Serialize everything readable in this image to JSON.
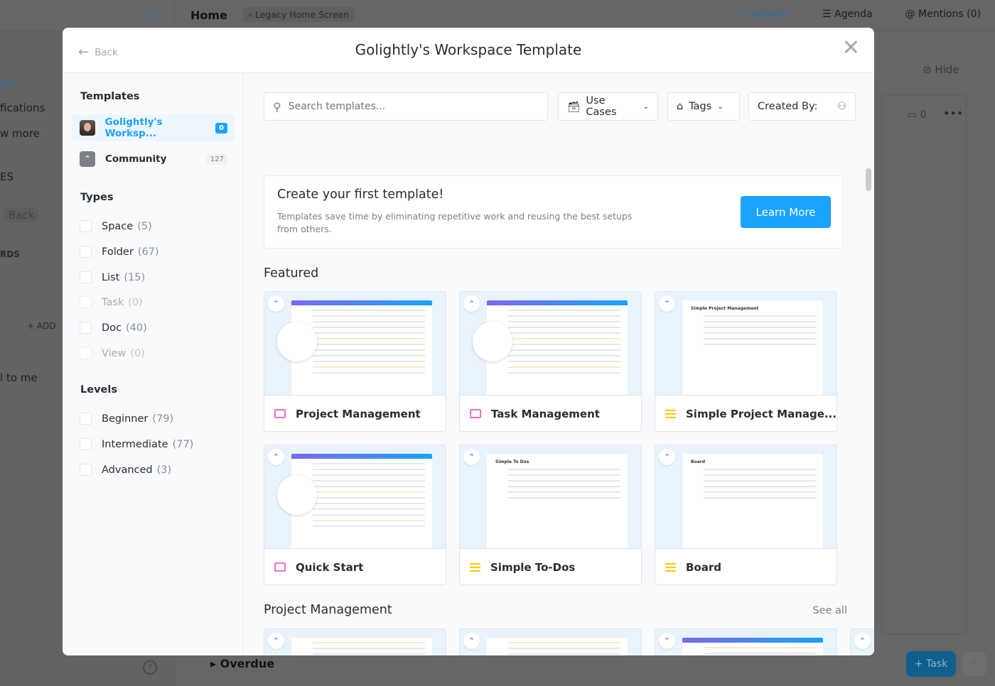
{
  "app": {
    "home": "Home",
    "legacy_home": "Legacy Home Screen",
    "top_nav": [
      "Calendar",
      "Agenda",
      "Mentions (0)"
    ],
    "left_items": [
      "ne",
      "fications",
      "w more",
      "ES",
      "Back",
      "RDS",
      "+ ADD",
      "l to me"
    ],
    "hide": "Hide",
    "calendar_count": "0",
    "overdue": "Overdue",
    "task_button": "+ Task"
  },
  "modal": {
    "back": "Back",
    "title": "Golightly's Workspace Template",
    "sidebar": {
      "templates_heading": "Templates",
      "sources": [
        {
          "label": "Golightly's Worksp...",
          "count": "0"
        },
        {
          "label": "Community",
          "count": "127"
        }
      ],
      "types_heading": "Types",
      "types": [
        {
          "label": "Space",
          "count": "(5)"
        },
        {
          "label": "Folder",
          "count": "(67)"
        },
        {
          "label": "List",
          "count": "(15)"
        },
        {
          "label": "Task",
          "count": "(0)"
        },
        {
          "label": "Doc",
          "count": "(40)"
        },
        {
          "label": "View",
          "count": "(0)"
        }
      ],
      "levels_heading": "Levels",
      "levels": [
        {
          "label": "Beginner",
          "count": "(79)"
        },
        {
          "label": "Intermediate",
          "count": "(77)"
        },
        {
          "label": "Advanced",
          "count": "(3)"
        }
      ]
    },
    "search_placeholder": "Search templates...",
    "filters": {
      "use_cases": "Use Cases",
      "tags": "Tags",
      "created_by": "Created By:"
    },
    "banner": {
      "title": "Create your first template!",
      "text": "Templates save time by eliminating repetitive work and reusing the best setups from others.",
      "button": "Learn More"
    },
    "featured_heading": "Featured",
    "featured": [
      {
        "name": "Project Management",
        "icon": "folder-icon"
      },
      {
        "name": "Task Management",
        "icon": "folder-icon"
      },
      {
        "name": "Simple Project Manage...",
        "icon": "list-icon"
      },
      {
        "name": "Quick Start",
        "icon": "folder-icon"
      },
      {
        "name": "Simple To-Dos",
        "icon": "list-icon"
      },
      {
        "name": "Board",
        "icon": "list-icon"
      }
    ],
    "thumb_titles": [
      "Simple Project Management",
      "Simple To Dos",
      "Board"
    ],
    "pm_heading": "Project Management",
    "see_all": "See all",
    "colors": {
      "accent": "#1aa3ff",
      "folder": "#f06ec3",
      "list": "#ffc800"
    }
  }
}
